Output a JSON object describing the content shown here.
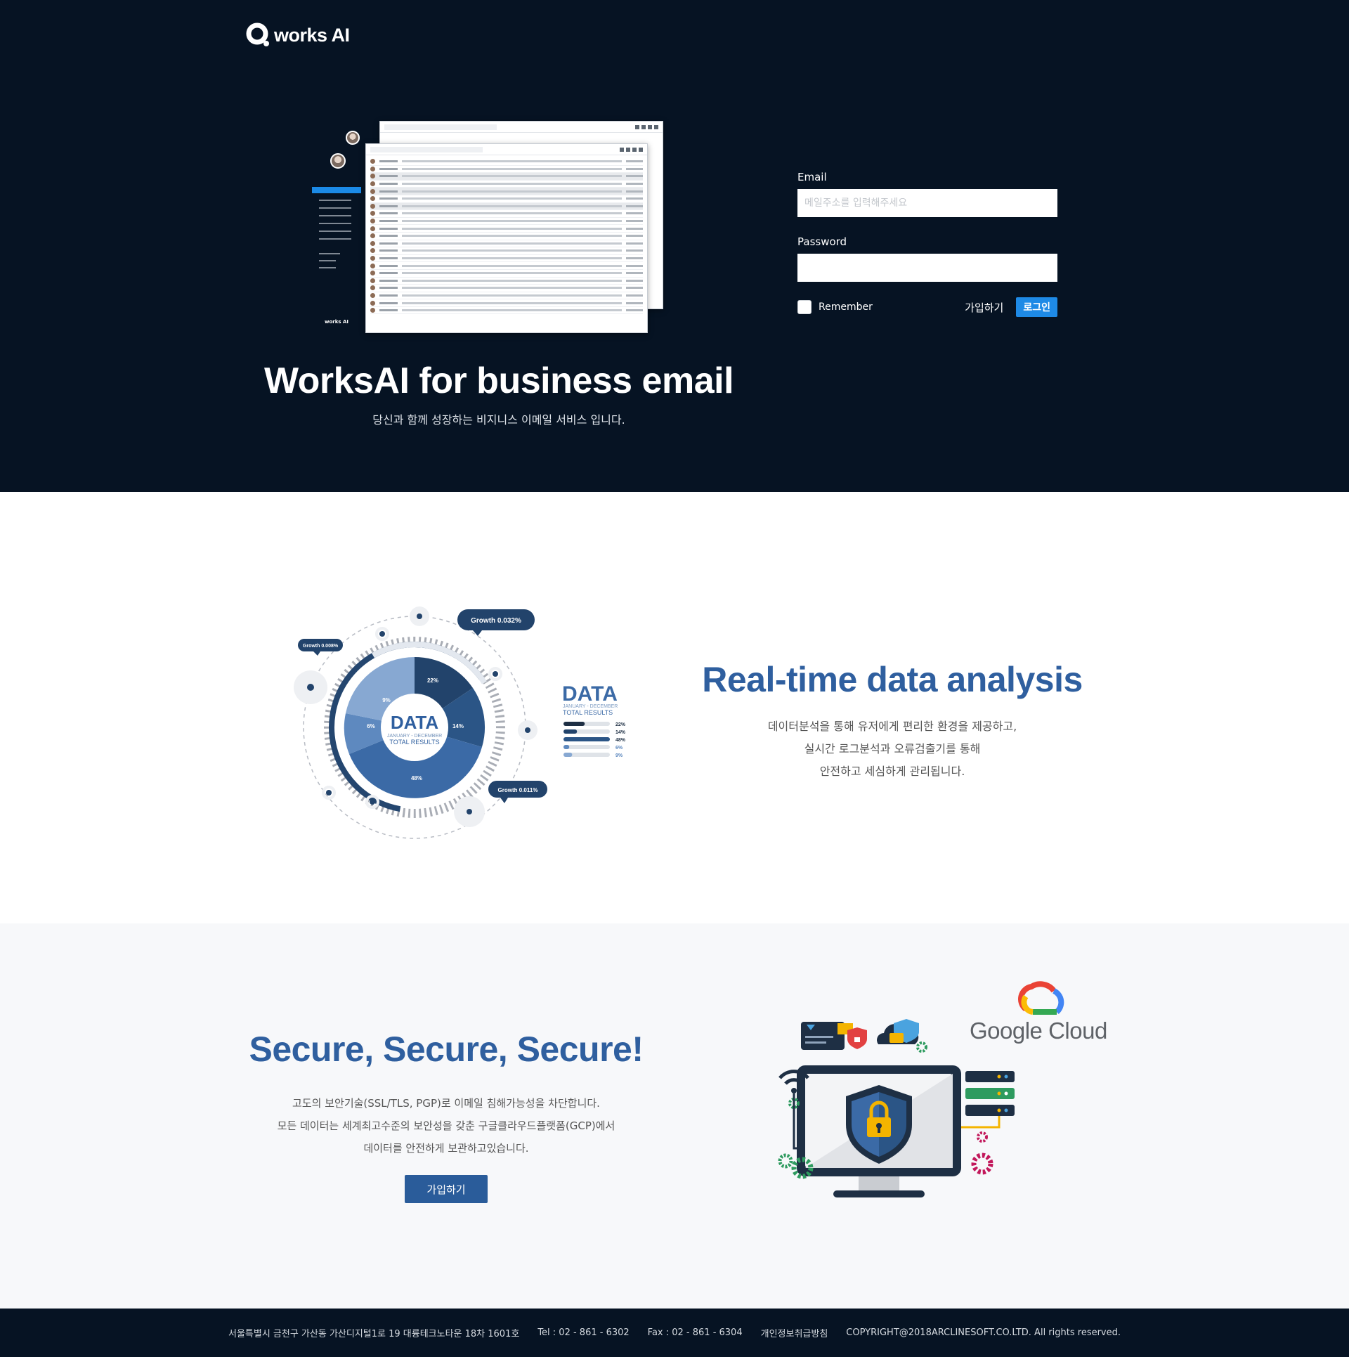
{
  "brand": {
    "logo_text": "works AI"
  },
  "hero": {
    "title": "WorksAI for business email",
    "subtitle": "당신과 함께 성장하는 비지니스 이메일 서비스 입니다.",
    "mock_logo": "works AI"
  },
  "login": {
    "email_label": "Email",
    "email_placeholder": "메일주소를 입력해주세요",
    "password_label": "Password",
    "remember_label": "Remember",
    "signup_link": "가입하기",
    "login_button": "로그인"
  },
  "data_section": {
    "title": "Real-time data analysis",
    "desc_lines": [
      "데이터분석을 통해 유저에게 편리한 환경을 제공하고,",
      "실시간 로그분석과 오류검출기를 통해",
      "안전하고 세심하게 관리됩니다."
    ],
    "graphic": {
      "center_title": "DATA",
      "center_sub1": "JANUARY - DECEMBER",
      "center_sub2": "TOTAL RESULTS",
      "segments": [
        "22%",
        "14%",
        "48%",
        "6%",
        "9%"
      ],
      "bubbles": [
        "Growth 0.032%",
        "Growth 0.008%",
        "Growth 0.011%"
      ],
      "legend_title": "DATA",
      "legend_sub1": "JANUARY - DECEMBER",
      "legend_sub2": "TOTAL RESULTS",
      "legend_values": [
        "22%",
        "14%",
        "48%",
        "6%",
        "9%"
      ]
    }
  },
  "secure_section": {
    "title": "Secure, Secure, Secure!",
    "desc_lines": [
      "고도의 보안기술(SSL/TLS, PGP)로  이메일 침해가능성을 차단합니다.",
      "모든 데이터는 세계최고수준의 보안성을 갖춘 구글클라우드플랫폼(GCP)에서",
      "데이터를 안전하게 보관하고있습니다."
    ],
    "signup_button": "가입하기",
    "cloud_brand": "Google Cloud"
  },
  "footer": {
    "address": "서울특별시 금천구 가산동 가산디지털1로 19 대륭테크노타운 18차 1601호",
    "tel": "Tel : 02 - 861 - 6302",
    "fax": "Fax : 02 - 861 - 6304",
    "privacy": "개인정보취급방침",
    "copyright": "COPYRIGHT@2018ARCLINESOFT.CO.LTD. All rights reserved."
  },
  "colors": {
    "hero_bg": "#061323",
    "accent_blue": "#1e8ae6",
    "heading_blue": "#2f5f9f",
    "button_blue": "#2a5c9a"
  }
}
